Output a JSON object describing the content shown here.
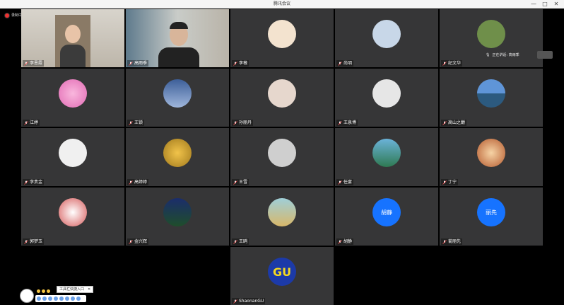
{
  "window": {
    "title": "腾讯会议",
    "min": "—",
    "max": "□",
    "close": "✕"
  },
  "recording": {
    "label": "录制中"
  },
  "speaking": {
    "label": "正在讲话: 高雨季"
  },
  "participants": [
    {
      "name": "李恩霞",
      "kind": "video-woman"
    },
    {
      "name": "高雨季",
      "kind": "video-man",
      "active": true
    },
    {
      "name": "李薇",
      "kind": "cartoon"
    },
    {
      "name": "尚明",
      "kind": "shop"
    },
    {
      "name": "纪文华",
      "kind": "plant"
    },
    {
      "name": "江婷",
      "kind": "pink-flower"
    },
    {
      "name": "王锁",
      "kind": "blue-scene"
    },
    {
      "name": "孙丽丹",
      "kind": "cat"
    },
    {
      "name": "王泉博",
      "kind": "default-user"
    },
    {
      "name": "高山之巅",
      "kind": "lake"
    },
    {
      "name": "李贵金",
      "kind": "bw-girl"
    },
    {
      "name": "高婷婷",
      "kind": "ginkgo"
    },
    {
      "name": "王雪",
      "kind": "grey-photo"
    },
    {
      "name": "任宴",
      "kind": "landscape"
    },
    {
      "name": "丁宁",
      "kind": "lights"
    },
    {
      "name": "郭梦玉",
      "kind": "bear"
    },
    {
      "name": "金兴辉",
      "kind": "night"
    },
    {
      "name": "王鸥",
      "kind": "painting"
    },
    {
      "name": "胡静",
      "kind": "blue-initials",
      "initials": "胡静"
    },
    {
      "name": "菊丽先",
      "kind": "blue-initials",
      "initials": "丽先"
    },
    {
      "name": "ShaonanGU",
      "kind": "gu-logo",
      "initials": "GU"
    }
  ],
  "float": {
    "entry_label": "工具栏快捷入口",
    "close": "✕"
  }
}
